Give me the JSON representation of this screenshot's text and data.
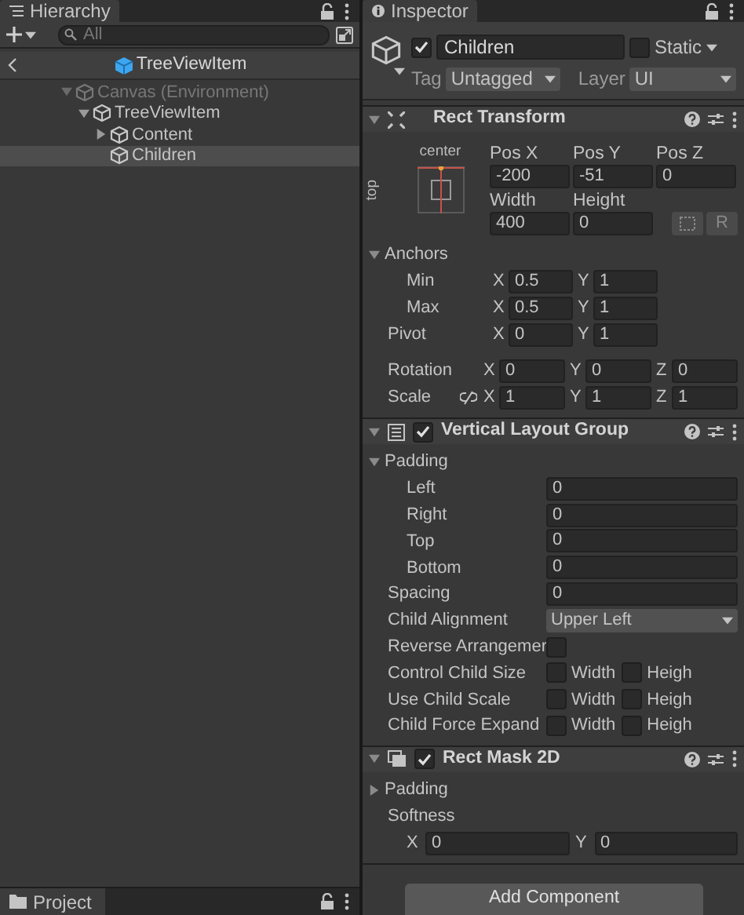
{
  "hierarchy": {
    "title": "Hierarchy",
    "search": {
      "placeholder": "All"
    },
    "breadcrumb": "TreeViewItem",
    "tree": [
      {
        "label": "Canvas (Environment)",
        "dimmed": true,
        "expanded": true,
        "selected": false,
        "children": [
          {
            "label": "TreeViewItem",
            "dimmed": false,
            "expanded": true,
            "selected": false,
            "children": [
              {
                "label": "Content",
                "dimmed": false,
                "expanded": false,
                "selected": false
              },
              {
                "label": "Children",
                "dimmed": false,
                "selected": true
              }
            ]
          }
        ]
      }
    ]
  },
  "inspector": {
    "title": "Inspector",
    "object": {
      "active": true,
      "name": "Children",
      "static": false,
      "static_label": "Static",
      "tag_label": "Tag",
      "tag": "Untagged",
      "layer_label": "Layer",
      "layer": "UI"
    },
    "components": [
      {
        "kind": "rect_transform",
        "title": "Rect Transform",
        "expanded": true,
        "anchor_preset": {
          "horizontal": "center",
          "vertical": "top"
        },
        "grid": [
          [
            {
              "label": "Pos X",
              "value": "-200"
            },
            {
              "label": "Pos Y",
              "value": "-51"
            },
            {
              "label": "Pos Z",
              "value": "0"
            }
          ],
          [
            {
              "label": "Width",
              "value": "400"
            },
            {
              "label": "Height",
              "value": "0"
            }
          ]
        ],
        "raw_button": "R",
        "anchors": {
          "label": "Anchors",
          "expanded": true,
          "rows": [
            {
              "label": "Min",
              "axes": [
                {
                  "axis": "X",
                  "value": "0.5"
                },
                {
                  "axis": "Y",
                  "value": "1"
                }
              ]
            },
            {
              "label": "Max",
              "axes": [
                {
                  "axis": "X",
                  "value": "0.5"
                },
                {
                  "axis": "Y",
                  "value": "1"
                }
              ]
            }
          ]
        },
        "rows": [
          {
            "label": "Pivot",
            "axes": [
              {
                "axis": "X",
                "value": "0"
              },
              {
                "axis": "Y",
                "value": "1"
              }
            ]
          },
          {
            "label": "Rotation",
            "axes": [
              {
                "axis": "X",
                "value": "0"
              },
              {
                "axis": "Y",
                "value": "0"
              },
              {
                "axis": "Z",
                "value": "0"
              }
            ]
          },
          {
            "label": "Scale",
            "axes": [
              {
                "axis": "X",
                "value": "1"
              },
              {
                "axis": "Y",
                "value": "1"
              },
              {
                "axis": "Z",
                "value": "1"
              }
            ]
          }
        ]
      },
      {
        "kind": "vertical_layout_group",
        "title": "Vertical Layout Group",
        "enabled": true,
        "expanded": true,
        "padding": {
          "label": "Padding",
          "expanded": true,
          "rows": [
            {
              "label": "Left",
              "value": "0"
            },
            {
              "label": "Right",
              "value": "0"
            },
            {
              "label": "Top",
              "value": "0"
            },
            {
              "label": "Bottom",
              "value": "0"
            }
          ]
        },
        "rows": [
          {
            "kind": "number",
            "label": "Spacing",
            "value": "0"
          },
          {
            "kind": "dropdown",
            "label": "Child Alignment",
            "value": "Upper Left"
          },
          {
            "kind": "checkbox",
            "label": "Reverse Arrangemer",
            "checked": false
          },
          {
            "kind": "toggles",
            "label": "Control Child Size",
            "options": [
              {
                "label": "Width",
                "checked": false
              },
              {
                "label": "Heigh",
                "checked": false
              }
            ]
          },
          {
            "kind": "toggles",
            "label": "Use Child Scale",
            "options": [
              {
                "label": "Width",
                "checked": false
              },
              {
                "label": "Heigh",
                "checked": false
              }
            ]
          },
          {
            "kind": "toggles",
            "label": "Child Force Expand",
            "options": [
              {
                "label": "Width",
                "checked": false
              },
              {
                "label": "Heigh",
                "checked": false
              }
            ]
          }
        ]
      },
      {
        "kind": "rect_mask_2d",
        "title": "Rect Mask 2D",
        "enabled": true,
        "expanded": true,
        "padding": {
          "label": "Padding",
          "expanded": false
        },
        "softness": {
          "label": "Softness",
          "axes": [
            {
              "axis": "X",
              "value": "0"
            },
            {
              "axis": "Y",
              "value": "0"
            }
          ]
        }
      }
    ],
    "add_component": "Add Component"
  },
  "project": {
    "title": "Project"
  }
}
